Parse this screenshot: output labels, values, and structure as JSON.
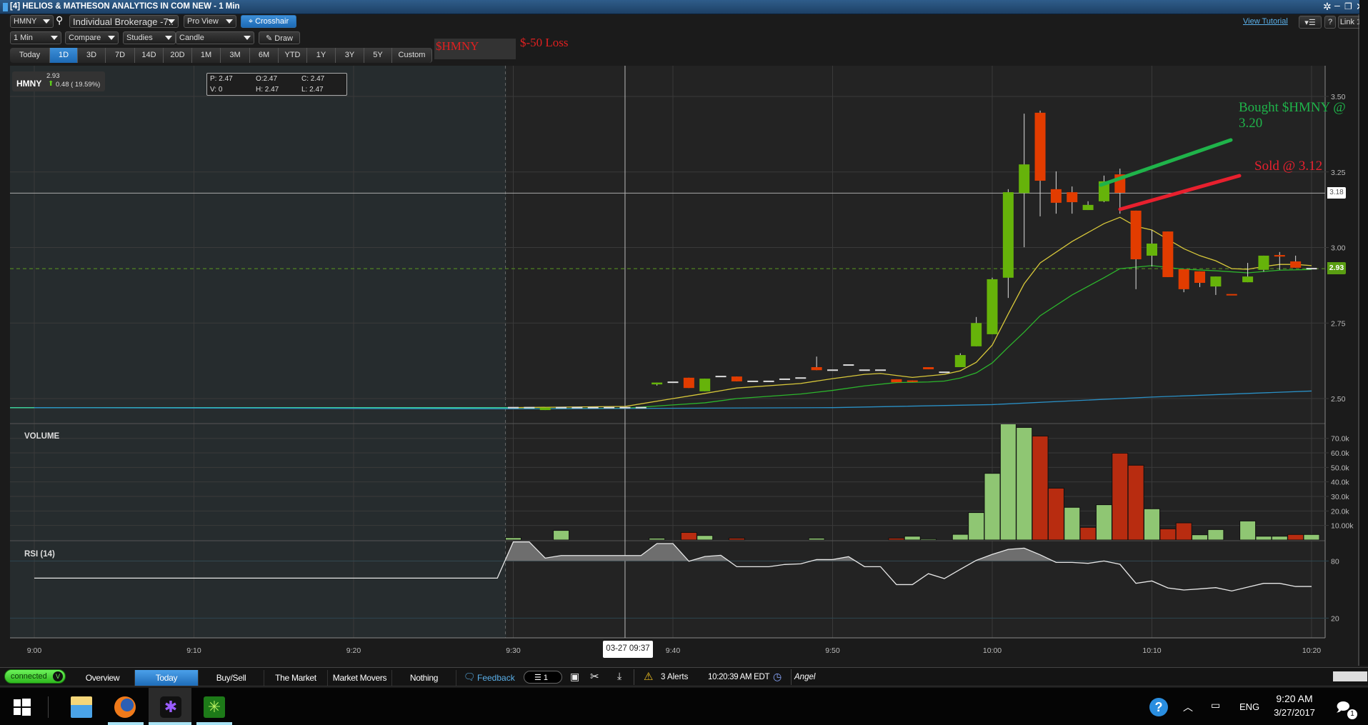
{
  "window": {
    "title": "[4] HELIOS & MATHESON ANALYTICS IN COM NEW - 1 Min",
    "controls": [
      "settings-icon",
      "minimize-icon",
      "restore-icon",
      "close-icon"
    ]
  },
  "toolbar": {
    "symbol": "HMNY",
    "account": "Individual Brokerage -7..",
    "view": "Pro View",
    "crosshair_label": "Crosshair",
    "interval": "1 Min",
    "compare": "Compare",
    "studies": "Studies",
    "chart_type": "Candle",
    "draw_label": "Draw",
    "view_tutorial": "View Tutorial",
    "help": "?",
    "link": "Link 1",
    "ranges": [
      "Today",
      "1D",
      "3D",
      "7D",
      "14D",
      "20D",
      "1M",
      "3M",
      "6M",
      "YTD",
      "1Y",
      "3Y",
      "5Y",
      "Custom"
    ],
    "active_range": "1D"
  },
  "annotations": {
    "symbol_note": "$HMNY",
    "loss_note": "$-50 Loss",
    "bought_line1": "Bought $HMNY @",
    "bought_line2": "3.20",
    "sold": "Sold @ 3.12",
    "colors": {
      "bought": "#1fb34a",
      "sold": "#e8202e"
    }
  },
  "quote": {
    "symbol": "HMNY",
    "last": "2.93",
    "change": "0.48 ( 19.59%)",
    "direction": "up"
  },
  "ohlc_box": {
    "p": "P: 2.47",
    "o": "O:2.47",
    "c": "C: 2.47",
    "v": "V: 0",
    "h": "H: 2.47",
    "l": "L: 2.47"
  },
  "crosshair": {
    "time_label": "03-27 09:37",
    "price_label": "3.18",
    "time": "9:37",
    "price": 3.18
  },
  "last_price_tag": "2.93",
  "chart_data": {
    "type": "candlestick",
    "symbol": "HMNY",
    "interval": "1 Min",
    "x_ticks": [
      "9:00",
      "9:10",
      "9:20",
      "9:30",
      "9:40",
      "9:50",
      "10:00",
      "10:10",
      "10:20"
    ],
    "price_ticks": [
      "3.50",
      "3.25",
      "3.00",
      "2.75",
      "2.50"
    ],
    "ylim": [
      2.45,
      3.55
    ],
    "premarket_end": "9:30",
    "candles": [
      [
        "9:30",
        2.47,
        2.47,
        2.47,
        2.47
      ],
      [
        "9:31",
        2.47,
        2.47,
        2.47,
        2.47
      ],
      [
        "9:32",
        2.462,
        2.47,
        2.462,
        2.47
      ],
      [
        "9:33",
        2.47,
        2.47,
        2.47,
        2.47
      ],
      [
        "9:34",
        2.47,
        2.47,
        2.47,
        2.47
      ],
      [
        "9:35",
        2.47,
        2.47,
        2.47,
        2.47
      ],
      [
        "9:36",
        2.47,
        2.47,
        2.47,
        2.47
      ],
      [
        "9:37",
        2.47,
        2.47,
        2.47,
        2.47
      ],
      [
        "9:38",
        2.47,
        2.47,
        2.47,
        2.47
      ],
      [
        "9:39",
        2.547,
        2.553,
        2.543,
        2.553
      ],
      [
        "9:40",
        2.554,
        2.554,
        2.554,
        2.554
      ],
      [
        "9:41",
        2.569,
        2.569,
        2.535,
        2.535
      ],
      [
        "9:42",
        2.524,
        2.566,
        2.524,
        2.566
      ],
      [
        "9:43",
        2.573,
        2.573,
        2.573,
        2.573
      ],
      [
        "9:44",
        2.573,
        2.573,
        2.557,
        2.557
      ],
      [
        "9:45",
        2.557,
        2.557,
        2.557,
        2.557
      ],
      [
        "9:46",
        2.557,
        2.557,
        2.557,
        2.557
      ],
      [
        "9:47",
        2.564,
        2.564,
        2.564,
        2.564
      ],
      [
        "9:48",
        2.568,
        2.568,
        2.568,
        2.568
      ],
      [
        "9:49",
        2.604,
        2.639,
        2.594,
        2.594
      ],
      [
        "9:50",
        2.594,
        2.594,
        2.594,
        2.594
      ],
      [
        "9:51",
        2.611,
        2.611,
        2.611,
        2.611
      ],
      [
        "9:52",
        2.594,
        2.594,
        2.594,
        2.594
      ],
      [
        "9:53",
        2.594,
        2.594,
        2.594,
        2.594
      ],
      [
        "9:54",
        2.564,
        2.564,
        2.554,
        2.554
      ],
      [
        "9:55",
        2.56,
        2.56,
        2.555,
        2.555
      ],
      [
        "9:56",
        2.604,
        2.604,
        2.597,
        2.597
      ],
      [
        "9:57",
        2.587,
        2.587,
        2.587,
        2.587
      ],
      [
        "9:58",
        2.604,
        2.65,
        2.604,
        2.644
      ],
      [
        "9:59",
        2.673,
        2.77,
        2.673,
        2.75
      ],
      [
        "10:00",
        2.713,
        2.9,
        2.713,
        2.895
      ],
      [
        "10:01",
        2.9,
        3.193,
        2.833,
        3.183
      ],
      [
        "10:02",
        3.18,
        3.443,
        3.001,
        3.275
      ],
      [
        "10:03",
        3.446,
        3.453,
        3.103,
        3.221
      ],
      [
        "10:04",
        3.193,
        3.252,
        3.112,
        3.148
      ],
      [
        "10:05",
        3.183,
        3.202,
        3.112,
        3.15
      ],
      [
        "10:06",
        3.124,
        3.153,
        3.124,
        3.141
      ],
      [
        "10:07",
        3.153,
        3.238,
        3.15,
        3.219
      ],
      [
        "10:08",
        3.242,
        3.261,
        3.112,
        3.181
      ],
      [
        "10:09",
        3.122,
        3.122,
        2.862,
        2.961
      ],
      [
        "10:10",
        2.973,
        3.058,
        2.937,
        3.013
      ],
      [
        "10:11",
        3.053,
        3.053,
        2.902,
        2.902
      ],
      [
        "10:12",
        2.928,
        2.928,
        2.852,
        2.862
      ],
      [
        "10:13",
        2.921,
        2.921,
        2.869,
        2.883
      ],
      [
        "10:14",
        2.871,
        2.904,
        2.843,
        2.904
      ],
      [
        "10:15",
        2.846,
        2.846,
        2.843,
        2.843
      ],
      [
        "10:16",
        2.885,
        2.949,
        2.885,
        2.904
      ],
      [
        "10:17",
        2.926,
        2.973,
        2.92,
        2.973
      ],
      [
        "10:18",
        2.975,
        2.985,
        2.926,
        2.97
      ],
      [
        "10:19",
        2.954,
        2.973,
        2.933,
        2.933
      ],
      [
        "10:20",
        2.93,
        2.93,
        2.93,
        2.93
      ]
    ],
    "premarket_line": {
      "from": "9:00",
      "to": "9:30",
      "price": 2.47
    },
    "moving_averages": [
      {
        "name": "fast",
        "color": "#d8c83a",
        "points": [
          [
            "9:30",
            2.47
          ],
          [
            "9:37",
            2.474
          ],
          [
            "9:40",
            2.5
          ],
          [
            "9:42",
            2.517
          ],
          [
            "9:44",
            2.535
          ],
          [
            "9:48",
            2.55
          ],
          [
            "9:50",
            2.566
          ],
          [
            "9:52",
            2.58
          ],
          [
            "9:53",
            2.583
          ],
          [
            "9:55",
            2.57
          ],
          [
            "9:57",
            2.58
          ],
          [
            "9:58",
            2.592
          ],
          [
            "9:59",
            2.62
          ],
          [
            "10:00",
            2.677
          ],
          [
            "10:01",
            2.78
          ],
          [
            "10:02",
            2.88
          ],
          [
            "10:03",
            2.949
          ],
          [
            "10:05",
            3.02
          ],
          [
            "10:07",
            3.079
          ],
          [
            "10:08",
            3.1
          ],
          [
            "10:09",
            3.07
          ],
          [
            "10:10",
            3.058
          ],
          [
            "10:12",
            2.996
          ],
          [
            "10:13",
            2.973
          ],
          [
            "10:14",
            2.956
          ],
          [
            "10:15",
            2.93
          ],
          [
            "10:16",
            2.928
          ],
          [
            "10:17",
            2.937
          ],
          [
            "10:18",
            2.944
          ],
          [
            "10:19",
            2.944
          ],
          [
            "10:20",
            2.94
          ]
        ]
      },
      {
        "name": "slow",
        "color": "#2cb52c",
        "points": [
          [
            "9:30",
            2.466
          ],
          [
            "9:37",
            2.468
          ],
          [
            "9:40",
            2.479
          ],
          [
            "9:42",
            2.486
          ],
          [
            "9:44",
            2.5
          ],
          [
            "9:48",
            2.515
          ],
          [
            "9:50",
            2.527
          ],
          [
            "9:52",
            2.542
          ],
          [
            "9:54",
            2.553
          ],
          [
            "9:56",
            2.555
          ],
          [
            "9:57",
            2.558
          ],
          [
            "9:58",
            2.568
          ],
          [
            "9:59",
            2.585
          ],
          [
            "10:00",
            2.618
          ],
          [
            "10:01",
            2.67
          ],
          [
            "10:02",
            2.72
          ],
          [
            "10:03",
            2.774
          ],
          [
            "10:05",
            2.843
          ],
          [
            "10:07",
            2.9
          ],
          [
            "10:08",
            2.93
          ],
          [
            "10:10",
            2.94
          ],
          [
            "10:12",
            2.928
          ],
          [
            "10:14",
            2.923
          ],
          [
            "10:16",
            2.916
          ],
          [
            "10:18",
            2.925
          ],
          [
            "10:20",
            2.927
          ]
        ]
      },
      {
        "name": "long",
        "color": "#2a8fc4",
        "points": [
          [
            "9:00",
            2.47
          ],
          [
            "9:30",
            2.466
          ],
          [
            "9:50",
            2.47
          ],
          [
            "10:00",
            2.48
          ],
          [
            "10:10",
            2.505
          ],
          [
            "10:20",
            2.525
          ]
        ]
      }
    ],
    "volume": {
      "label": "VOLUME",
      "ticks": [
        "70.0k",
        "60.0k",
        "50.0k",
        "40.0k",
        "30.0k",
        "20.0k",
        "10.00k"
      ],
      "tick_values": [
        70,
        60,
        50,
        40,
        30,
        20,
        10
      ],
      "unit": "thousands",
      "bars": [
        [
          "9:30",
          1.6,
          "up"
        ],
        [
          "9:33",
          6.6,
          "up"
        ],
        [
          "9:39",
          1.3,
          "up"
        ],
        [
          "9:41",
          5.2,
          "down"
        ],
        [
          "9:42",
          3.1,
          "up"
        ],
        [
          "9:44",
          1.3,
          "down"
        ],
        [
          "9:49",
          1.3,
          "up"
        ],
        [
          "9:54",
          1.3,
          "down"
        ],
        [
          "9:55",
          2.6,
          "up"
        ],
        [
          "9:56",
          0.8,
          "up"
        ],
        [
          "9:58",
          3.9,
          "up"
        ],
        [
          "9:59",
          18.9,
          "up"
        ],
        [
          "10:00",
          45.9,
          "up"
        ],
        [
          "10:01",
          80.8,
          "up"
        ],
        [
          "10:02",
          77.5,
          "up"
        ],
        [
          "10:03",
          71.6,
          "down"
        ],
        [
          "10:04",
          35.7,
          "down"
        ],
        [
          "10:05",
          22.5,
          "up"
        ],
        [
          "10:06",
          8.7,
          "down"
        ],
        [
          "10:07",
          24.3,
          "up"
        ],
        [
          "10:08",
          59.8,
          "down"
        ],
        [
          "10:09",
          51.5,
          "down"
        ],
        [
          "10:10",
          21.5,
          "up"
        ],
        [
          "10:11",
          7.7,
          "down"
        ],
        [
          "10:12",
          11.8,
          "down"
        ],
        [
          "10:13",
          3.6,
          "up"
        ],
        [
          "10:14",
          7.2,
          "up"
        ],
        [
          "10:16",
          13.1,
          "up"
        ],
        [
          "10:17",
          2.6,
          "up"
        ],
        [
          "10:18",
          2.6,
          "up"
        ],
        [
          "10:19",
          3.8,
          "down"
        ],
        [
          "10:20",
          3.8,
          "up"
        ]
      ]
    },
    "rsi": {
      "label": "RSI (14)",
      "ticks": [
        "80",
        "20"
      ],
      "tick_values": [
        80,
        20
      ],
      "premarket_value": 62,
      "points": [
        [
          "9:00",
          62
        ],
        [
          "9:29",
          62
        ],
        [
          "9:30",
          100
        ],
        [
          "9:31",
          100
        ],
        [
          "9:32",
          83
        ],
        [
          "9:33",
          85.7
        ],
        [
          "9:38",
          85.7
        ],
        [
          "9:39",
          98.3
        ],
        [
          "9:40",
          98.3
        ],
        [
          "9:41",
          79.7
        ],
        [
          "9:42",
          84.7
        ],
        [
          "9:43",
          86
        ],
        [
          "9:44",
          74
        ],
        [
          "9:46",
          74
        ],
        [
          "9:47",
          76.3
        ],
        [
          "9:48",
          77
        ],
        [
          "9:49",
          81.5
        ],
        [
          "9:50",
          81.5
        ],
        [
          "9:51",
          84.5
        ],
        [
          "9:52",
          74
        ],
        [
          "9:53",
          74
        ],
        [
          "9:54",
          55.2
        ],
        [
          "9:55",
          55.2
        ],
        [
          "9:56",
          66.7
        ],
        [
          "9:57",
          61.5
        ],
        [
          "9:58",
          71.2
        ],
        [
          "9:59",
          80.7
        ],
        [
          "10:00",
          86.9
        ],
        [
          "10:01",
          92.2
        ],
        [
          "10:02",
          93.5
        ],
        [
          "10:03",
          86.5
        ],
        [
          "10:04",
          78.5
        ],
        [
          "10:05",
          78.5
        ],
        [
          "10:06",
          77.5
        ],
        [
          "10:07",
          80
        ],
        [
          "10:08",
          76.5
        ],
        [
          "10:09",
          56.5
        ],
        [
          "10:10",
          59
        ],
        [
          "10:11",
          51.7
        ],
        [
          "10:12",
          49.5
        ],
        [
          "10:13",
          50.7
        ],
        [
          "10:14",
          52
        ],
        [
          "10:15",
          48.5
        ],
        [
          "10:16",
          52.5
        ],
        [
          "10:17",
          56.5
        ],
        [
          "10:18",
          56.5
        ],
        [
          "10:19",
          53.2
        ],
        [
          "10:20",
          53.2
        ]
      ]
    },
    "colors": {
      "up": "#66b30a",
      "down": "#e23c00",
      "vol_up": "#8fc673",
      "vol_down": "#b82c10"
    }
  },
  "statusbar": {
    "connection": "connected",
    "tabs": [
      "Overview",
      "Today",
      "Buy/Sell",
      "The Market",
      "Market Movers",
      "Nothing"
    ],
    "active_tab": "Today",
    "feedback": "Feedback",
    "layout_count": "1",
    "alerts": "3 Alerts",
    "clock": "10:20:39 AM EDT",
    "user": "Angel"
  },
  "taskbar": {
    "apps": [
      "start-icon",
      "file-explorer-icon",
      "firefox-icon",
      "trading-app-icon",
      "green-app-icon"
    ],
    "language": "ENG",
    "time": "9:20 AM",
    "date": "3/27/2017",
    "notifications": "1"
  }
}
